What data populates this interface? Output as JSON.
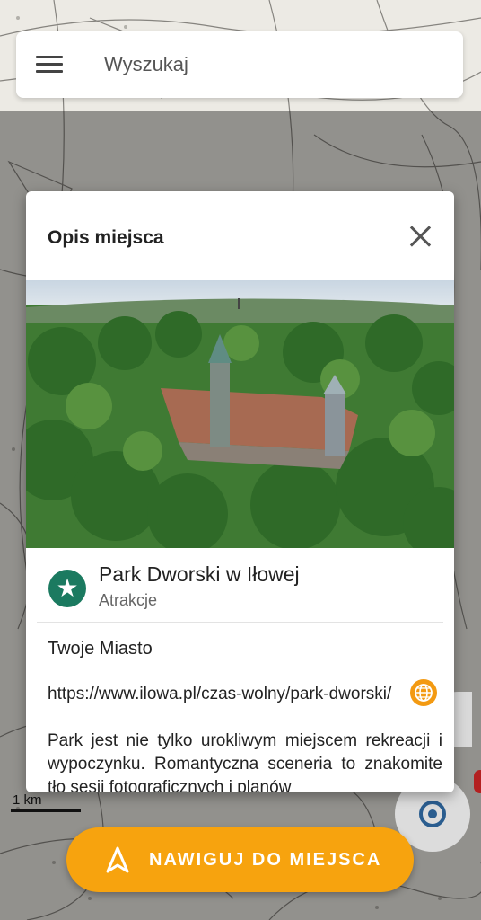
{
  "search": {
    "placeholder": "Wyszukaj",
    "menu_icon": "menu-icon"
  },
  "dialog": {
    "title": "Opis miejsca",
    "close_icon": "close-icon",
    "place": {
      "name": "Park Dworski w Iłowej",
      "category": "Atrakcje",
      "category_icon": "star-icon",
      "badge_color": "#1b7a60"
    },
    "source": "Twoje Miasto",
    "url": "https://www.ilowa.pl/czas-wolny/park-dworski/",
    "url_icon": "globe-icon",
    "description": "Park jest nie tylko urokliwym miejscem rekreacji i wypoczynku. Romantyczna sceneria to znakomite tło sesji fotograficznych i planów"
  },
  "map": {
    "scale_label": "1 km",
    "location_icon": "my-location-icon"
  },
  "navigate_button": {
    "label": "NAWIGUJ DO MIEJSCA",
    "icon": "navigation-arrow-icon",
    "color": "#f7a30e"
  }
}
